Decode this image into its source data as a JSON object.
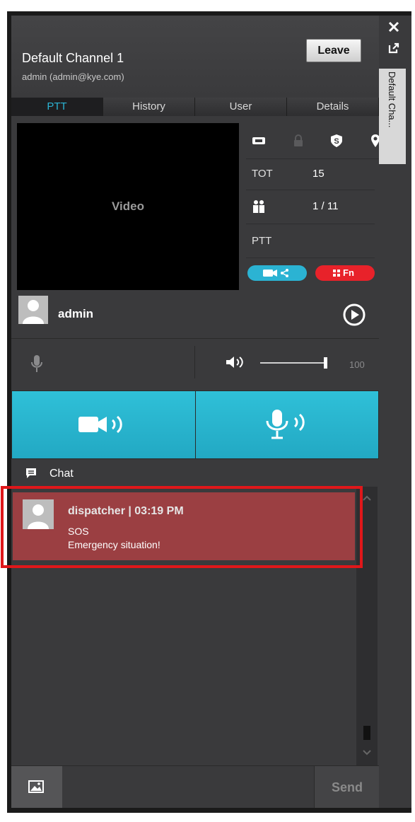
{
  "header": {
    "title": "Default Channel 1",
    "subtitle": "admin (admin@kye.com)",
    "leave_label": "Leave"
  },
  "tabs": [
    {
      "label": "PTT",
      "active": true
    },
    {
      "label": "History"
    },
    {
      "label": "User"
    },
    {
      "label": "Details"
    }
  ],
  "video": {
    "label": "Video"
  },
  "info": {
    "tot_label": "TOT",
    "tot_value": "15",
    "users_value": "1 / 11",
    "ptt_label": "PTT",
    "fn_label": "Fn"
  },
  "user": {
    "name": "admin"
  },
  "volume": {
    "value": "100",
    "level": 1.0
  },
  "chat": {
    "title": "Chat",
    "messages": [
      {
        "header": "dispatcher | 03:19 PM",
        "lines": [
          "SOS",
          "Emergency situation!"
        ]
      }
    ]
  },
  "bottom": {
    "send_label": "Send"
  },
  "sidebar": {
    "tab_label": "Default Cha..."
  },
  "colors": {
    "accent": "#2bb3d3",
    "alert": "#9b3f42",
    "highlight": "#e0171a",
    "fn_red": "#e8222a"
  }
}
